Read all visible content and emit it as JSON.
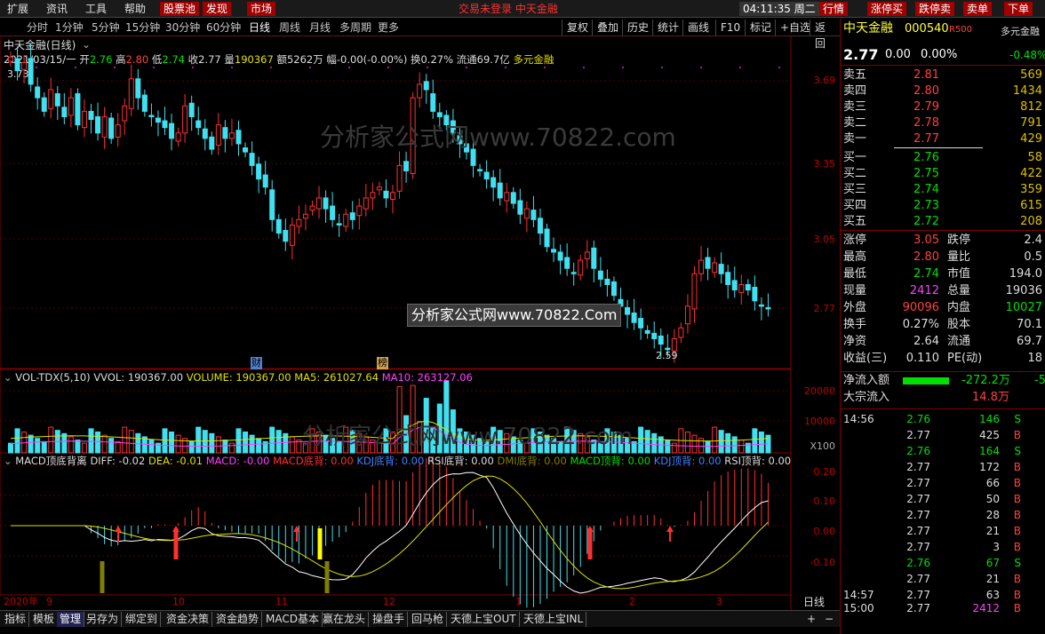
{
  "menu": {
    "items": [
      "扩展",
      "资讯",
      "工具",
      "帮助",
      "股票池",
      "发现",
      "市场"
    ],
    "center_text": "交易未登录 中天金融",
    "clock": "04:11:35 周二",
    "right_buttons": [
      "行情",
      "涨停买",
      "跌停卖",
      "卖单",
      "下单"
    ]
  },
  "toolbar": {
    "periods": [
      "分时",
      "1分钟",
      "5分钟",
      "15分钟",
      "30分钟",
      "60分钟",
      "日线",
      "周线",
      "月线",
      "多周期",
      "更多"
    ],
    "selected": "日线",
    "right": [
      "复权",
      "叠加",
      "历史",
      "统计",
      "画线",
      "F10",
      "标记",
      "+自选",
      "返回"
    ]
  },
  "chart_header": {
    "title": "中天金融(日线)",
    "date": "2021/03/15/一",
    "open_label": "开",
    "open": "2.76",
    "high_label": "高",
    "high": "2.80",
    "low_label": "低",
    "low": "2.74",
    "close_label": "收",
    "close": "2.77",
    "vol_label": "量",
    "vol": "190367",
    "amount": "额5262万",
    "change": "幅-0.00(-0.00%)",
    "turnover": "换0.27%",
    "float": "流通69.7亿",
    "sector": "多元金融",
    "max_label": "3.73",
    "min_label": "2.59",
    "marks": [
      "财",
      "榜"
    ]
  },
  "watermark": {
    "main": "分析家公式网www.70822.com",
    "badge": "分析家公式网www.70822.Com"
  },
  "chart_data": [
    {
      "type": "candlestick",
      "title": "中天金融(日线)",
      "ylim": [
        2.55,
        3.78
      ],
      "y_ticks": [
        "3.69",
        "3.35",
        "3.05",
        "2.77"
      ],
      "x_month_labels": [
        "2020年",
        "9",
        "10",
        "11",
        "12",
        "1",
        "2",
        "3"
      ],
      "ohlc_note": "close values per day (oldest to newest)",
      "closes": [
        3.7,
        3.65,
        3.68,
        3.6,
        3.55,
        3.5,
        3.58,
        3.52,
        3.48,
        3.55,
        3.45,
        3.5,
        3.47,
        3.42,
        3.48,
        3.4,
        3.45,
        3.52,
        3.62,
        3.55,
        3.5,
        3.48,
        3.46,
        3.44,
        3.4,
        3.42,
        3.52,
        3.48,
        3.44,
        3.4,
        3.36,
        3.45,
        3.4,
        3.42,
        3.38,
        3.35,
        3.3,
        3.25,
        3.22,
        3.1,
        3.05,
        3.02,
        3.08,
        3.1,
        3.12,
        3.15,
        3.18,
        3.14,
        3.1,
        3.08,
        3.12,
        3.1,
        3.15,
        3.18,
        3.2,
        3.22,
        3.18,
        3.2,
        3.3,
        3.28,
        3.55,
        3.6,
        3.58,
        3.5,
        3.48,
        3.45,
        3.42,
        3.38,
        3.35,
        3.3,
        3.28,
        3.25,
        3.22,
        3.18,
        3.2,
        3.16,
        3.12,
        3.14,
        3.1,
        3.05,
        3.0,
        2.98,
        2.95,
        2.92,
        2.9,
        2.95,
        2.98,
        2.92,
        2.88,
        2.86,
        2.82,
        2.78,
        2.75,
        2.72,
        2.7,
        2.68,
        2.66,
        2.64,
        2.62,
        2.66,
        2.7,
        2.78,
        2.9,
        2.95,
        2.92,
        2.94,
        2.9,
        2.86,
        2.84,
        2.86,
        2.84,
        2.8,
        2.78,
        2.77
      ]
    },
    {
      "type": "bar",
      "title": "VOL-TDX(5,10)",
      "header": {
        "vvol": "VVOL: 190367.00",
        "volume": "VOLUME: 190367.00",
        "ma5": "MA5: 261027.64",
        "ma10": "MA10: 263127.06"
      },
      "y_ticks": [
        "20000",
        "10000",
        "X100"
      ],
      "ylim": [
        0,
        26000
      ]
    },
    {
      "type": "bar",
      "title": "MACD顶底背离",
      "header": {
        "diff": "DIFF: -0.02",
        "dea": "DEA: -0.01",
        "macd": "MACD: -0.00",
        "macd_bottom": "MACD底背: 0.00",
        "kdj_bottom": "KDJ底背: 0.00",
        "rsi_bottom": "RSI底背: 0.00",
        "dmi_bottom": "DMI底背: 0.00",
        "macd_top": "MACD顶背: 0.00",
        "kdj_top": "KDJ顶背: 0.00",
        "rsi_top": "RSI顶背: 0.00"
      },
      "y_ticks": [
        "0.20",
        "0.10",
        "0.00",
        "-0.10"
      ],
      "ylim": [
        -0.14,
        0.24
      ]
    }
  ],
  "bottom_axis": {
    "labels": [
      "2020年",
      "9",
      "10",
      "11",
      "12",
      "1",
      "2",
      "3"
    ],
    "period": "日线"
  },
  "bottom_tabs": [
    "指标",
    "模板",
    "管理",
    "另存为",
    "绑定到",
    "资金决策",
    "资金趋势",
    "MACD基本",
    "赢在龙头",
    "操盘手",
    "回马枪",
    "天德上宝OUT",
    "天德上宝INL"
  ],
  "bottom_tabs_selected": "管理",
  "quote": {
    "name": "中天金融",
    "code": "000540",
    "rflag": "R500",
    "sector": "多元金融",
    "sector_pct": "-0.48%",
    "price": "2.77",
    "change": "0.00",
    "pct": "0.00%",
    "asks": [
      [
        "卖五",
        "2.81",
        "569"
      ],
      [
        "卖四",
        "2.80",
        "1434"
      ],
      [
        "卖三",
        "2.79",
        "812"
      ],
      [
        "卖二",
        "2.78",
        "791"
      ],
      [
        "卖一",
        "2.77",
        "429"
      ]
    ],
    "bids": [
      [
        "买一",
        "2.76",
        "58"
      ],
      [
        "买二",
        "2.75",
        "422"
      ],
      [
        "买三",
        "2.74",
        "359"
      ],
      [
        "买四",
        "2.73",
        "615"
      ],
      [
        "买五",
        "2.72",
        "208"
      ]
    ],
    "stats": [
      [
        "涨停",
        "3.05",
        "跌停",
        "2.4"
      ],
      [
        "最高",
        "2.80",
        "量比",
        "0.5"
      ],
      [
        "最低",
        "2.74",
        "市值",
        "194.0"
      ],
      [
        "现量",
        "2412",
        "总量",
        "19036"
      ],
      [
        "外盘",
        "90096",
        "内盘",
        "10027"
      ],
      [
        "换手",
        "0.27%",
        "股本",
        "70.1"
      ],
      [
        "净资",
        "2.64",
        "流通",
        "69.7"
      ],
      [
        "收益(三)",
        "0.110",
        "PE(动)",
        "18"
      ]
    ],
    "netflow_label": "净流入额",
    "netflow": "-272.2万",
    "netflow_extra": "-5",
    "block_label": "大宗流入",
    "block": "14.8万",
    "ticks": [
      [
        "14:56",
        "2.76",
        "146",
        "S"
      ],
      [
        "",
        "2.77",
        "425",
        "B"
      ],
      [
        "",
        "2.76",
        "164",
        "S"
      ],
      [
        "",
        "2.77",
        "172",
        "B"
      ],
      [
        "",
        "2.77",
        "66",
        "B"
      ],
      [
        "",
        "2.77",
        "50",
        "B"
      ],
      [
        "",
        "2.77",
        "28",
        "B"
      ],
      [
        "",
        "2.77",
        "21",
        "B"
      ],
      [
        "",
        "2.77",
        "3",
        "B"
      ],
      [
        "",
        "2.76",
        "67",
        "S"
      ],
      [
        "",
        "2.77",
        "21",
        "B"
      ],
      [
        "14:57",
        "2.77",
        "63",
        "B"
      ],
      [
        "15:00",
        "2.77",
        "2412",
        "B"
      ]
    ]
  }
}
